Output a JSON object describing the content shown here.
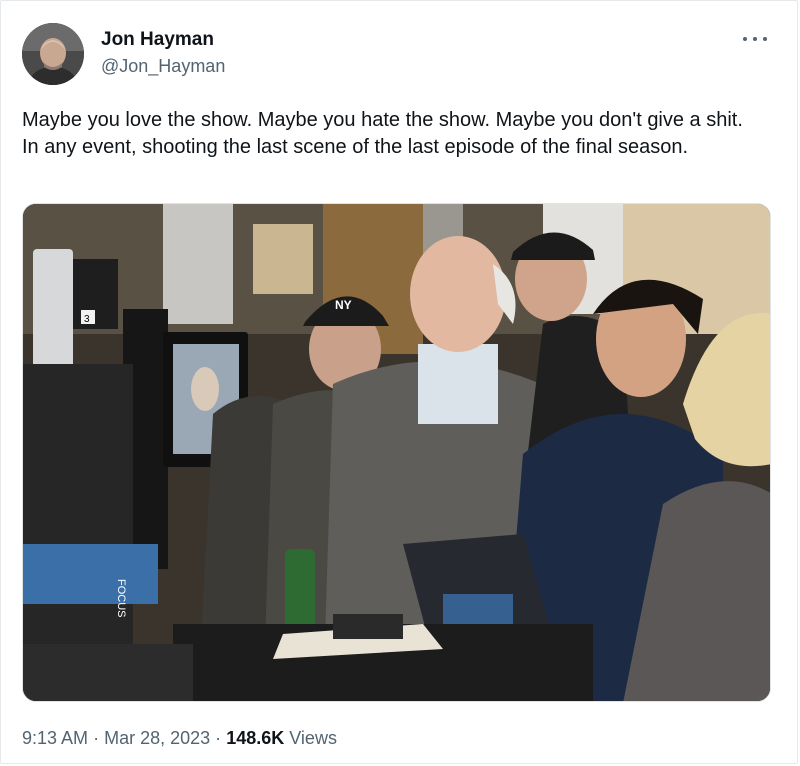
{
  "author": {
    "display_name": "Jon Hayman",
    "handle": "@Jon_Hayman",
    "avatar_icon": "profile-photo-bald-man"
  },
  "more_icon": "ellipsis-icon",
  "tweet": {
    "text": "Maybe you love the show. Maybe you hate the show. Maybe you don't give a shit. In any event, shooting the last scene of the last episode of the final season."
  },
  "media": {
    "description_icon": "photo-film-set-monitor-crew",
    "camera_label": "3",
    "tape_label": "FOCUS",
    "cap_logo": "NY"
  },
  "meta": {
    "time": "9:13 AM",
    "separator": "·",
    "date": "Mar 28, 2023",
    "views_count": "148.6K",
    "views_label": "Views"
  },
  "colors": {
    "text_primary": "#0f1419",
    "text_secondary": "#536471",
    "border": "#e6e9ec"
  }
}
